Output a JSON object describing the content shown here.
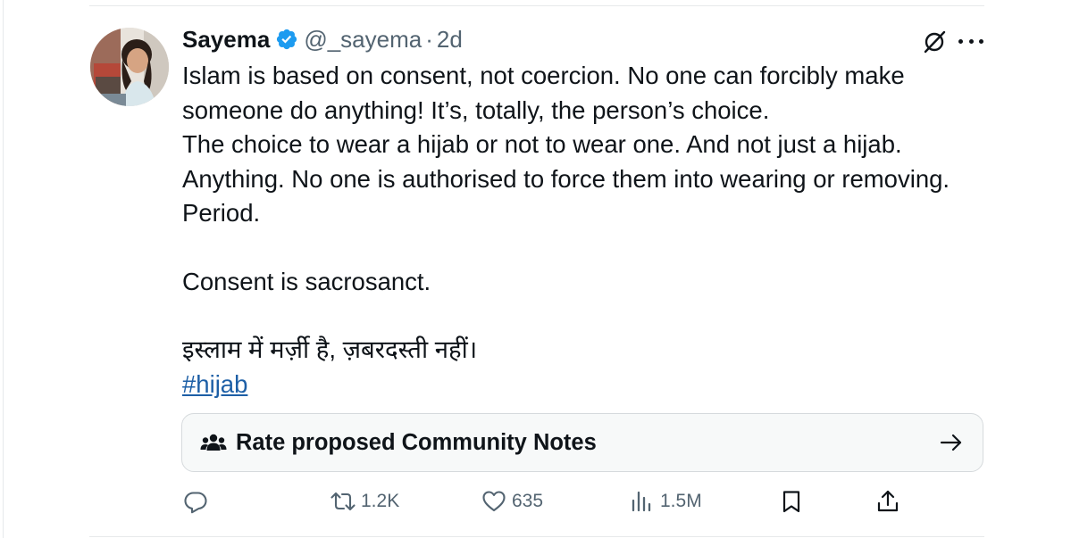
{
  "tweet": {
    "author_name": "Sayema",
    "handle": "@_sayema",
    "separator": "·",
    "time": "2d",
    "text_lines": [
      "Islam is based on consent, not coercion. No one can forcibly make",
      "someone do anything! It’s, totally, the person’s choice.",
      "The choice to wear a hijab or not to wear one. And not just a hijab.",
      "Anything. No one is authorised to force them into wearing or removing.",
      "Period."
    ],
    "text_line_2": "Consent is sacrosanct.",
    "text_line_3": "इस्लाम में मर्ज़ी है, ज़बरदस्ती नहीं।",
    "hashtag": "#hijab"
  },
  "community_notes": {
    "label": "Rate proposed Community Notes"
  },
  "actions": {
    "replies": "",
    "reposts": "1.2K",
    "likes": "635",
    "views": "1.5M"
  },
  "icons": {
    "verified": "verified-badge-icon",
    "grok": "grok-icon",
    "more": "more-icon",
    "community": "community-icon",
    "arrow": "arrow-right-icon",
    "reply": "reply-icon",
    "repost": "repost-icon",
    "like": "like-icon",
    "views": "views-icon",
    "bookmark": "bookmark-icon",
    "share": "share-icon"
  },
  "colors": {
    "text": "#0f1419",
    "muted": "#536471",
    "link": "#1d5fa6",
    "verified": "#1d9bf0"
  }
}
